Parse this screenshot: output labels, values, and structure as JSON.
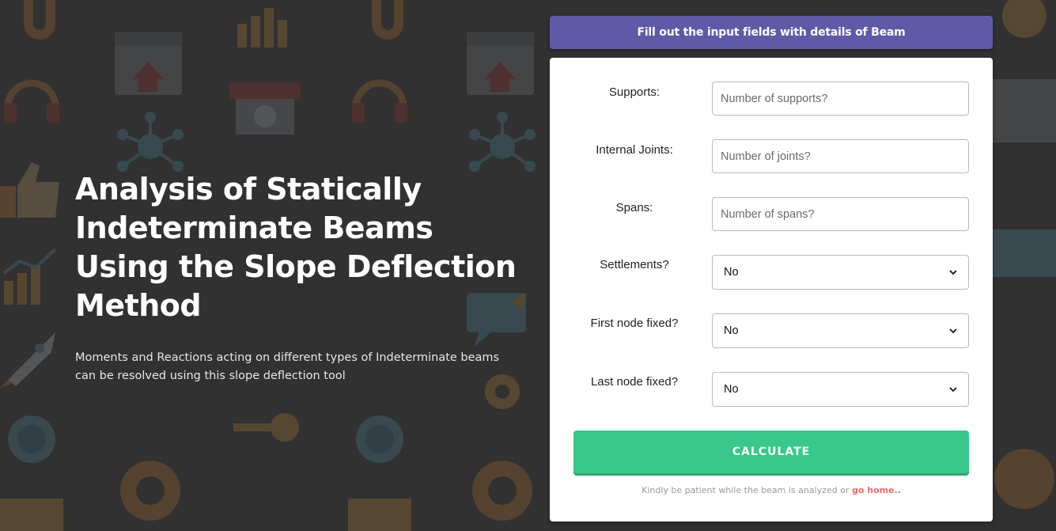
{
  "hero": {
    "title": "Analysis of Statically Indeterminate Beams Using the Slope Deflection Method",
    "description": "Moments and Reactions acting on different types of Indeterminate beams can be resolved using this slope deflection tool"
  },
  "form": {
    "header": "Fill out the input fields with details of Beam",
    "supports": {
      "label": "Supports:",
      "placeholder": "Number of supports?"
    },
    "joints": {
      "label": "Internal Joints:",
      "placeholder": "Number of joints?"
    },
    "spans": {
      "label": "Spans:",
      "placeholder": "Number of spans?"
    },
    "settlements": {
      "label": "Settlements?",
      "value": "No"
    },
    "first_node": {
      "label": "First node fixed?",
      "value": "No"
    },
    "last_node": {
      "label": "Last node fixed?",
      "value": "No"
    },
    "calculate_label": "CALCULATE",
    "footnote_text": "Kindly be patient while the beam is analyzed or ",
    "footnote_link": "go home.."
  },
  "colors": {
    "background": "#3a3a3a",
    "header_bar": "#5f5aa8",
    "calculate_button": "#38c889",
    "link": "#f06b6b"
  }
}
